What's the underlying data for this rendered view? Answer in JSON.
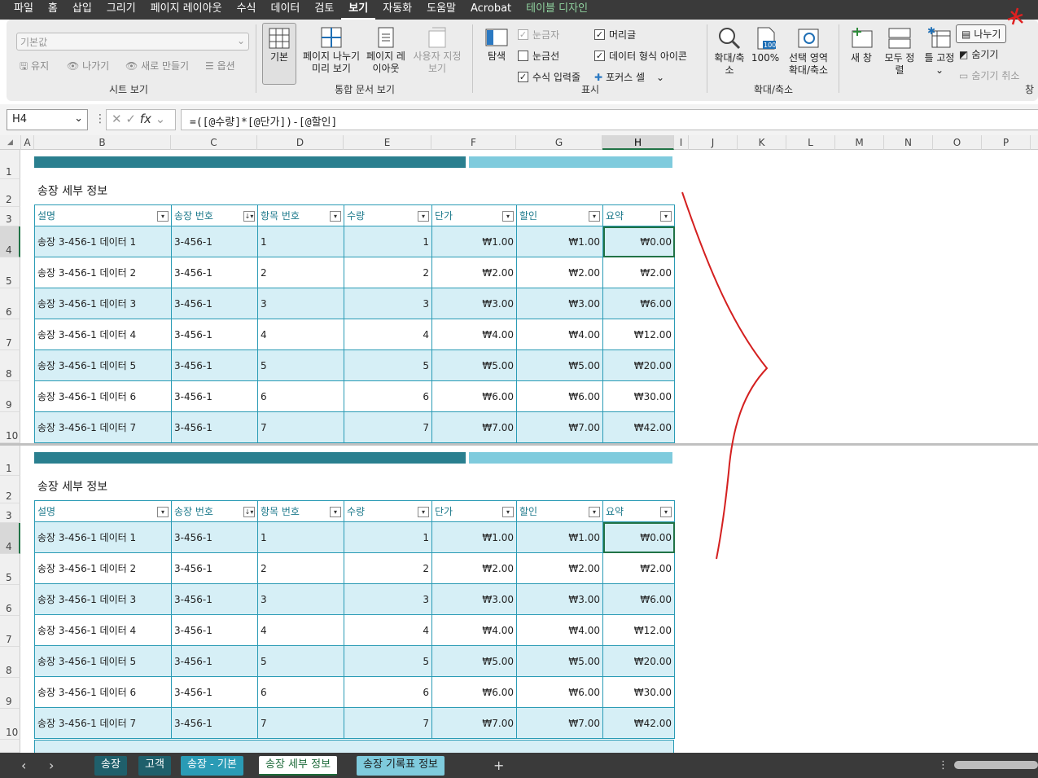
{
  "menu": [
    "파일",
    "홈",
    "삽입",
    "그리기",
    "페이지 레이아웃",
    "수식",
    "데이터",
    "검토",
    "보기",
    "자동화",
    "도움말",
    "Acrobat",
    "테이블 디자인"
  ],
  "ribbon": {
    "sheet_view": {
      "combo_value": "기본값",
      "keep": "유지",
      "exit": "나가기",
      "new": "새로 만들기",
      "options": "옵션",
      "label": "시트 보기"
    },
    "workbook_views": {
      "normal": "기본",
      "page_break": "페이지 나누기 미리 보기",
      "page_layout": "페이지 레이아웃",
      "custom": "사용자 지정 보기",
      "label": "통합 문서 보기"
    },
    "show": {
      "navigate": "탐색",
      "ruler": "눈금자",
      "gridlines": "눈금선",
      "formula_bar": "수식 입력줄",
      "headings": "머리글",
      "data_type_icons": "데이터 형식 아이콘",
      "focus_cell": "포커스 셀",
      "label": "표시"
    },
    "zoom": {
      "zoom": "확대/축소",
      "hundred": "100%",
      "zoom_selection": "선택 영역 확대/축소",
      "label": "확대/축소"
    },
    "window": {
      "new_window": "새 창",
      "arrange_all": "모두 정렬",
      "freeze": "틀 고정",
      "split": "나누기",
      "hide": "숨기기",
      "unhide": "숨기기 취소",
      "label": "창"
    }
  },
  "formula": {
    "name_box": "H4",
    "formula": "=([@수량]*[@단가])-[@할인]"
  },
  "columns": [
    "A",
    "B",
    "C",
    "D",
    "E",
    "F",
    "G",
    "H",
    "I",
    "J",
    "K",
    "L",
    "M",
    "N",
    "O",
    "P"
  ],
  "rows": [
    "1",
    "2",
    "3",
    "4",
    "5",
    "6",
    "7",
    "8",
    "9",
    "10"
  ],
  "table": {
    "title": "송장 세부 정보",
    "headers": [
      "설명",
      "송장 번호",
      "항목 번호",
      "수량",
      "단가",
      "할인",
      "요약"
    ],
    "rows": [
      [
        "송장 3-456-1 데이터 1",
        "3-456-1",
        "1",
        "1",
        "₩1.00",
        "₩1.00",
        "₩0.00"
      ],
      [
        "송장 3-456-1 데이터 2",
        "3-456-1",
        "2",
        "2",
        "₩2.00",
        "₩2.00",
        "₩2.00"
      ],
      [
        "송장 3-456-1 데이터 3",
        "3-456-1",
        "3",
        "3",
        "₩3.00",
        "₩3.00",
        "₩6.00"
      ],
      [
        "송장 3-456-1 데이터 4",
        "3-456-1",
        "4",
        "4",
        "₩4.00",
        "₩4.00",
        "₩12.00"
      ],
      [
        "송장 3-456-1 데이터 5",
        "3-456-1",
        "5",
        "5",
        "₩5.00",
        "₩5.00",
        "₩20.00"
      ],
      [
        "송장 3-456-1 데이터 6",
        "3-456-1",
        "6",
        "6",
        "₩6.00",
        "₩6.00",
        "₩30.00"
      ],
      [
        "송장 3-456-1 데이터 7",
        "3-456-1",
        "7",
        "7",
        "₩7.00",
        "₩7.00",
        "₩42.00"
      ]
    ]
  },
  "sheet_tabs": [
    {
      "label": "송장",
      "bg": "#1f5f6b",
      "fg": "#ffffff"
    },
    {
      "label": "고객",
      "bg": "#1f5f6b",
      "fg": "#ffffff"
    },
    {
      "label": "송장 - 기본",
      "bg": "#2a9bb5",
      "fg": "#ffffff"
    },
    {
      "label": "송장 세부 정보",
      "bg": "#ffffff",
      "fg": "#1e6b3a"
    },
    {
      "label": "송장 기록표 정보",
      "bg": "#7fcbdd",
      "fg": "#1a1a1a"
    }
  ],
  "add_sheet": "+"
}
